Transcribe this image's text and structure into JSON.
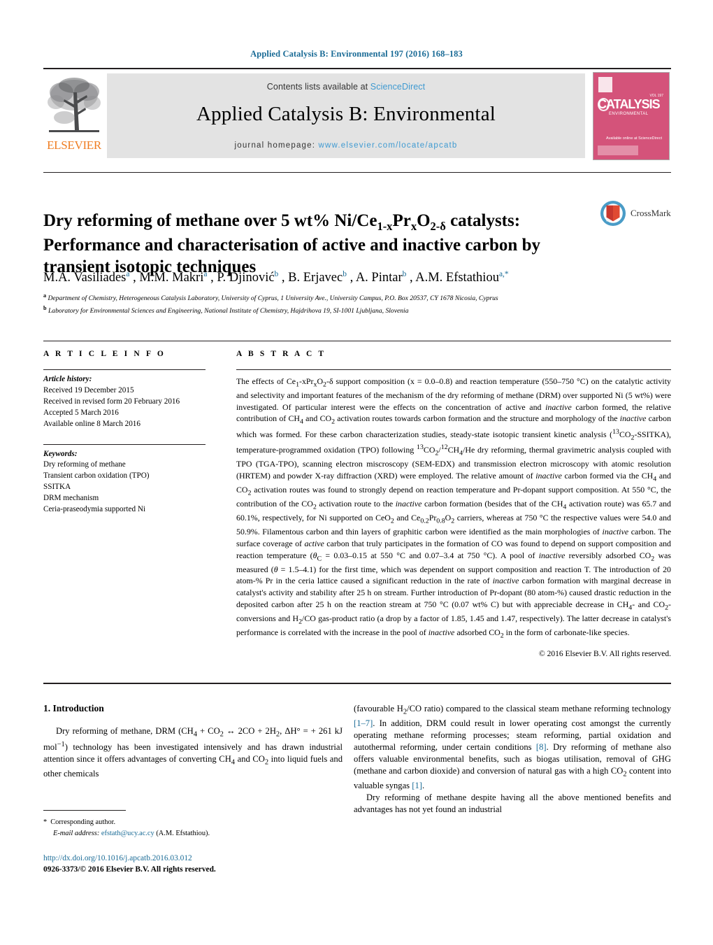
{
  "running_head": "Applied Catalysis B: Environmental 197 (2016) 168–183",
  "masthead": {
    "publisher": "ELSEVIER",
    "contents_prefix": "Contents lists available at ",
    "contents_link": "ScienceDirect",
    "journal_name": "Applied Catalysis B: Environmental",
    "homepage_prefix": "journal homepage: ",
    "homepage_url": "www.elsevier.com/locate/apcatb",
    "cover": {
      "title": "CATALYSIS",
      "subtitle": "ENVIRONMENTAL",
      "volume": "VOL 197",
      "sciencedirect": "Available online at ScienceDirect"
    }
  },
  "crossmark": {
    "label": "CrossMark"
  },
  "article": {
    "title_line1_pre": "Dry reforming of methane over 5 wt% Ni/Ce",
    "title_sub1": "1-x",
    "title_mid1": "Pr",
    "title_sub2": "x",
    "title_mid2": "O",
    "title_sub3": "2-δ",
    "title_line1_post": " catalysts:",
    "title_line2": "Performance and characterisation of active and inactive carbon by",
    "title_line3": "transient isotopic techniques",
    "authors": "M.A. Vasiliades a , M.M. Makri a , P. Djinović b , B. Erjavec b , A. Pintar b , A.M. Efstathiou a,*",
    "affiliation_a": "Department of Chemistry, Heterogeneous Catalysis Laboratory, University of Cyprus, 1 University Ave., University Campus, P.O. Box 20537, CY 1678 Nicosia, Cyprus",
    "affiliation_b": "Laboratory for Environmental Sciences and Engineering, National Institute of Chemistry, Hajdrihova 19, SI-1001 Ljubljana, Slovenia"
  },
  "article_info": {
    "heading": "A R T I C L E   I N F O",
    "history_label": "Article history:",
    "history": [
      "Received 19 December 2015",
      "Received in revised form 20 February 2016",
      "Accepted 5 March 2016",
      "Available online 8 March 2016"
    ],
    "keywords_label": "Keywords:",
    "keywords": [
      "Dry reforming of methane",
      "Transient carbon oxidation (TPO)",
      "SSITKA",
      "DRM mechanism",
      "Ceria-praseodymia supported Ni"
    ]
  },
  "abstract": {
    "heading": "A B S T R A C T",
    "text": "The effects of Ce1-xPrxO2-δ support composition (x = 0.0–0.8) and reaction temperature (550–750 °C) on the catalytic activity and selectivity and important features of the mechanism of the dry reforming of methane (DRM) over supported Ni (5 wt%) were investigated. Of particular interest were the effects on the concentration of active and inactive carbon formed, the relative contribution of CH4 and CO2 activation routes towards carbon formation and the structure and morphology of the inactive carbon which was formed. For these carbon characterization studies, steady-state isotopic transient kinetic analysis (13CO2-SSITKA), temperature-programmed oxidation (TPO) following 13CO2/12CH4/He dry reforming, thermal gravimetric analysis coupled with TPO (TGA-TPO), scanning electron miscroscopy (SEM-EDX) and transmission electron microscopy with atomic resolution (HRTEM) and powder X-ray diffraction (XRD) were employed. The relative amount of inactive carbon formed via the CH4 and CO2 activation routes was found to strongly depend on reaction temperature and Pr-dopant support composition. At 550 °C, the contribution of the CO2 activation route to the inactive carbon formation (besides that of the CH4 activation route) was 65.7 and 60.1%, respectively, for Ni supported on CeO2 and Ce0.2Pr0.8O2 carriers, whereas at 750 °C the respective values were 54.0 and 50.9%. Filamentous carbon and thin layers of graphitic carbon were identified as the main morphologies of inactive carbon. The surface coverage of active carbon that truly participates in the formation of CO was found to depend on support composition and reaction temperature (θC = 0.03–0.15 at 550 °C and 0.07–3.4 at 750 °C). A pool of inactive reversibly adsorbed CO2 was measured (θ = 1.5–4.1) for the first time, which was dependent on support composition and reaction T. The introduction of 20 atom-% Pr in the ceria lattice caused a significant reduction in the rate of inactive carbon formation with marginal decrease in catalyst's activity and stability after 25 h on stream. Further introduction of Pr-dopant (80 atom-%) caused drastic reduction in the deposited carbon after 25 h on the reaction stream at 750 °C (0.07 wt% C) but with appreciable decrease in CH4- and CO2-conversions and H2/CO gas-product ratio (a drop by a factor of 1.85, 1.45 and 1.47, respectively). The latter decrease in catalyst's performance is correlated with the increase in the pool of inactive adsorbed CO2 in the form of carbonate-like species.",
    "copyright": "© 2016 Elsevier B.V. All rights reserved."
  },
  "introduction": {
    "section_number": "1.",
    "section_title": "Introduction",
    "paragraph1": "Dry reforming of methane, DRM (CH4 + CO2 ↔ 2CO + 2H2, ΔH° = + 261 kJ mol−1) technology has been investigated intensively and has drawn industrial attention since it offers advantages of converting CH4 and CO2 into liquid fuels and other chemicals",
    "paragraph1_cont": "(favourable H2/CO ratio) compared to the classical steam methane reforming technology [1–7]. In addition, DRM could result in lower operating cost amongst the currently operating methane reforming processes; steam reforming, partial oxidation and autothermal reforming, under certain conditions [8]. Dry reforming of methane also offers valuable environmental benefits, such as biogas utilisation, removal of GHG (methane and carbon dioxide) and conversion of natural gas with a high CO2 content into valuable syngas [1].",
    "paragraph2": "Dry reforming of methane despite having all the above mentioned benefits and advantages has not yet found an industrial"
  },
  "footer": {
    "corresponding_star": "*",
    "corresponding_label": "Corresponding author.",
    "email_label": "E-mail address:",
    "email": "efstath@ucy.ac.cy",
    "email_owner": "(A.M. Efstathiou).",
    "doi": "http://dx.doi.org/10.1016/j.apcatb.2016.03.012",
    "issn_line": "0926-3373/© 2016 Elsevier B.V. All rights reserved."
  },
  "colors": {
    "link": "#1a6b96",
    "sciencedirect": "#3f9ad1",
    "elsevier_orange": "#ef7d22",
    "cover_pink": "#d4537a"
  }
}
